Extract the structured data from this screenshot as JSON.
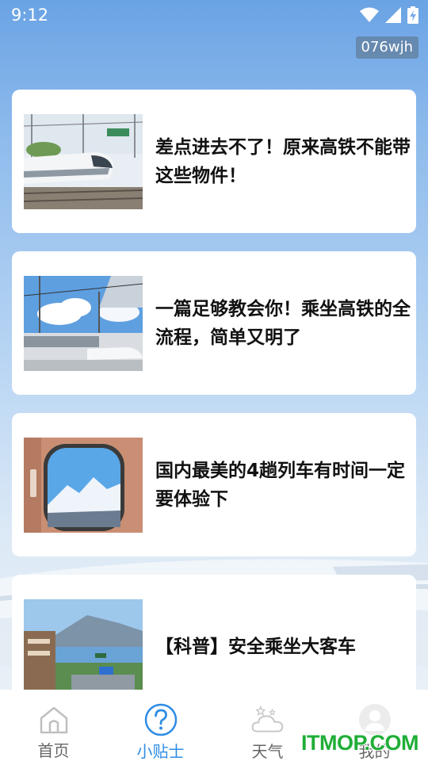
{
  "status_bar": {
    "time": "9:12",
    "icons": [
      "wifi-icon",
      "cellular-signal-icon",
      "battery-charging-icon"
    ]
  },
  "user_badge": "076wjh",
  "articles": [
    {
      "title": "差点进去不了！原来高铁不能带这些物件！",
      "thumb": "high-speed-train-station-photo"
    },
    {
      "title": "一篇足够教会你！乘坐高铁的全流程，简单又明了",
      "thumb": "train-platform-blue-sky-photo"
    },
    {
      "title": "国内最美的4趟列车有时间一定要体验下",
      "thumb": "snow-mountain-train-window-photo"
    },
    {
      "title": "【科普】安全乘坐大客车",
      "thumb": "coastal-town-road-photo"
    }
  ],
  "tabbar": {
    "tabs": [
      {
        "label": "首页",
        "icon": "home-icon",
        "active": false
      },
      {
        "label": "小贴士",
        "icon": "question-circle-icon",
        "active": true
      },
      {
        "label": "天气",
        "icon": "weather-cloud-icon",
        "active": false
      },
      {
        "label": "我的",
        "icon": "avatar-icon",
        "active": false
      }
    ]
  },
  "watermark": "ITMOP.COM",
  "colors": {
    "accent": "#2f8de4",
    "tab_inactive": "#666666",
    "watermark": "#1fae37"
  }
}
